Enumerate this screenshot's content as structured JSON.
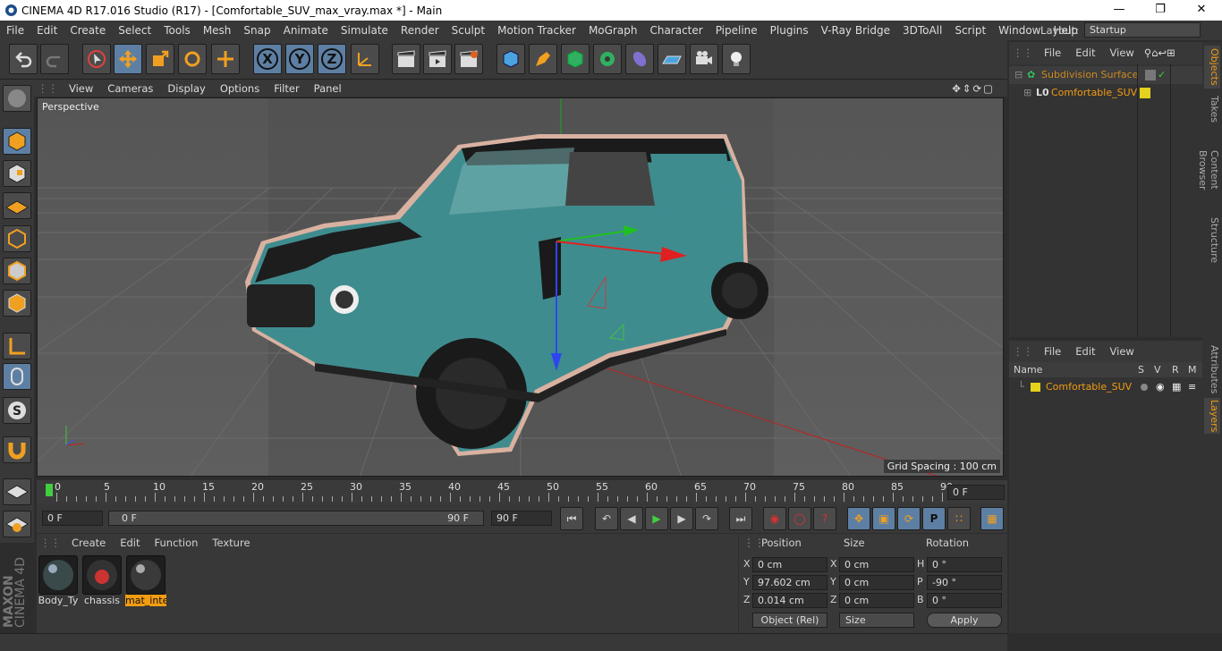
{
  "window": {
    "title": "CINEMA 4D R17.016 Studio (R17) - [Comfortable_SUV_max_vray.max *] - Main"
  },
  "menubar": [
    "File",
    "Edit",
    "Create",
    "Select",
    "Tools",
    "Mesh",
    "Snap",
    "Animate",
    "Simulate",
    "Render",
    "Sculpt",
    "Motion Tracker",
    "MoGraph",
    "Character",
    "Pipeline",
    "Plugins",
    "V-Ray Bridge",
    "3DToAll",
    "Script",
    "Window",
    "Help"
  ],
  "layout": {
    "label": "Layout:",
    "value": "Startup"
  },
  "toolbar": {
    "x": "X",
    "y": "Y",
    "z": "Z"
  },
  "viewport": {
    "menu": [
      "View",
      "Cameras",
      "Display",
      "Options",
      "Filter",
      "Panel"
    ],
    "camera": "Perspective",
    "grid_spacing": "Grid Spacing : 100 cm"
  },
  "timeline": {
    "ticks": [
      "0",
      "5",
      "10",
      "15",
      "20",
      "25",
      "30",
      "35",
      "40",
      "45",
      "50",
      "55",
      "60",
      "65",
      "70",
      "75",
      "80",
      "85",
      "90"
    ],
    "current_frame": "0 F"
  },
  "playback": {
    "start": "0 F",
    "range_start": "0 F",
    "range_end": "90 F",
    "end": "90 F"
  },
  "materials": {
    "menu": [
      "Create",
      "Edit",
      "Function",
      "Texture"
    ],
    "items": [
      "Body_Ty",
      "chassis",
      "mat_inte"
    ]
  },
  "coords": {
    "headers": [
      "Position",
      "Size",
      "Rotation"
    ],
    "rows": [
      {
        "axis": "X",
        "pos": "0 cm",
        "saxis": "X",
        "size": "0 cm",
        "raxis": "H",
        "rot": "0 °"
      },
      {
        "axis": "Y",
        "pos": "97.602 cm",
        "saxis": "Y",
        "size": "0 cm",
        "raxis": "P",
        "rot": "-90 °"
      },
      {
        "axis": "Z",
        "pos": "0.014 cm",
        "saxis": "Z",
        "size": "0 cm",
        "raxis": "B",
        "rot": "0 °"
      }
    ],
    "mode": "Object (Rel)",
    "size_mode": "Size",
    "apply": "Apply"
  },
  "objects": {
    "menu": [
      "File",
      "Edit",
      "View"
    ],
    "items": [
      "Subdivision Surface",
      "Comfortable_SUV"
    ]
  },
  "layers": {
    "menu": [
      "File",
      "Edit",
      "View"
    ],
    "headers": [
      "Name",
      "S",
      "V",
      "R",
      "M"
    ],
    "items": [
      "Comfortable_SUV"
    ]
  },
  "sidetabs": [
    "Objects",
    "Takes",
    "Content Browser",
    "Structure",
    "Attributes",
    "Layers"
  ],
  "brand": {
    "line1": "MAXON",
    "line2": "CINEMA 4D"
  },
  "colors": {
    "accent": "#f39c12",
    "selected": "#5d7fa3",
    "layer": "#e5d21c",
    "car": "#3f8c8f"
  }
}
